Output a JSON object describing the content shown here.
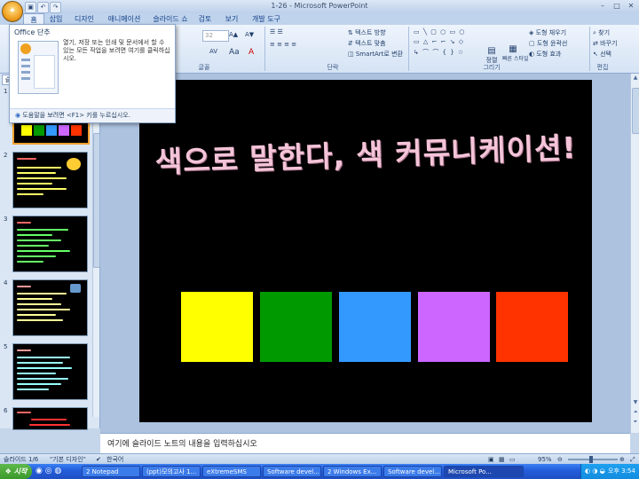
{
  "window": {
    "title": "1-26 - Microsoft PowerPoint"
  },
  "tabs": [
    "홈",
    "삽입",
    "디자인",
    "애니메이션",
    "슬라이드 쇼",
    "검토",
    "보기",
    "개발 도구"
  ],
  "ribbon": {
    "font_size": "32",
    "paragraph_items": [
      "텍스트 방향",
      "텍스트 맞춤",
      "SmartArt로 변환"
    ],
    "drawing_items": [
      "도형 채우기",
      "도형 윤곽선",
      "도형 효과"
    ],
    "arrange_label": "정렬",
    "quick_style_label": "빠른 스타일",
    "editing_items": [
      "찾기",
      "바꾸기",
      "선택"
    ],
    "groups": {
      "font": "글꼴",
      "paragraph": "단락",
      "drawing": "그리기",
      "editing": "편집"
    }
  },
  "office_popup": {
    "title": "Office 단추",
    "description": "열기, 저장 또는 인쇄 및 문서에서 할 수 있는 모든 작업을 보려면 여기를 클릭하십시오.",
    "help": "도움말을 보려면 <F1> 키를 누르십시오."
  },
  "panel_tab": "슬",
  "slides": [
    {
      "num": "1"
    },
    {
      "num": "2"
    },
    {
      "num": "3"
    },
    {
      "num": "4"
    },
    {
      "num": "5"
    },
    {
      "num": "6"
    }
  ],
  "slide": {
    "title": "색으로 말한다, 색 커뮤니케이션!",
    "swatches": [
      "#ffff00",
      "#009900",
      "#3399ff",
      "#cc66ff",
      "#ff3300"
    ]
  },
  "notes": {
    "placeholder": "여기에 슬라이드 노트의 내용을 입력하십시오"
  },
  "status": {
    "slide_info": "슬라이드 1/6",
    "theme": "\"기본 디자인\"",
    "language": "한국어",
    "zoom": "95%"
  },
  "taskbar": {
    "start": "시작",
    "tasks": [
      "2 Notepad",
      "(ppt)모의고사 1...",
      "eXtremeSMS",
      "Software devel...",
      "2 Windows Ex...",
      "Software devel...",
      "Microsoft Po..."
    ],
    "clock": "오후 3:54"
  }
}
